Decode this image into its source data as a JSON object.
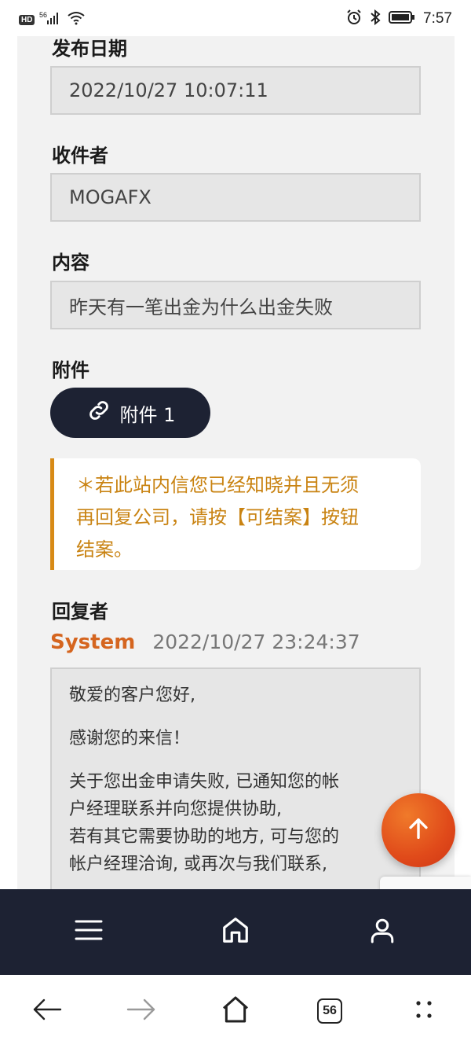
{
  "status_bar": {
    "hd_badge": "HD",
    "network": "56",
    "time": "7:57",
    "icons": [
      "signal-icon",
      "wifi-icon",
      "alarm-icon",
      "bluetooth-icon",
      "battery-icon"
    ]
  },
  "form": {
    "publish_date_label": "发布日期",
    "publish_date_value": "2022/10/27 10:07:11",
    "recipient_label": "收件者",
    "recipient_value": "MOGAFX",
    "content_label": "内容",
    "content_value": "昨天有一笔出金为什么出金失败",
    "attachment_label": "附件",
    "attachment_button": "附件 1"
  },
  "notice": {
    "line1": "＊若此站内信您已经知晓并且无须",
    "line2": "再回复公司，请按【可结案】按钮",
    "line3": "结案。",
    "accent_color": "#d78a16"
  },
  "reply": {
    "label": "回复者",
    "sender": "System",
    "timestamp": "2022/10/27 23:24:37",
    "paragraph1": "敬爱的客户您好,",
    "paragraph2": "感谢您的来信！",
    "paragraph3_line1": "关于您出金申请失败, 已通知您的帐",
    "paragraph3_line2": "户经理联系并向您提供协助,",
    "paragraph3_line3": "若有其它需要协助的地方, 可与您的",
    "paragraph3_line4": "帐户经理洽询, 或再次与我们联系,"
  },
  "app_nav": {
    "items": [
      "menu-icon",
      "home-icon",
      "user-icon"
    ]
  },
  "browser_bar": {
    "tab_count": "56"
  }
}
